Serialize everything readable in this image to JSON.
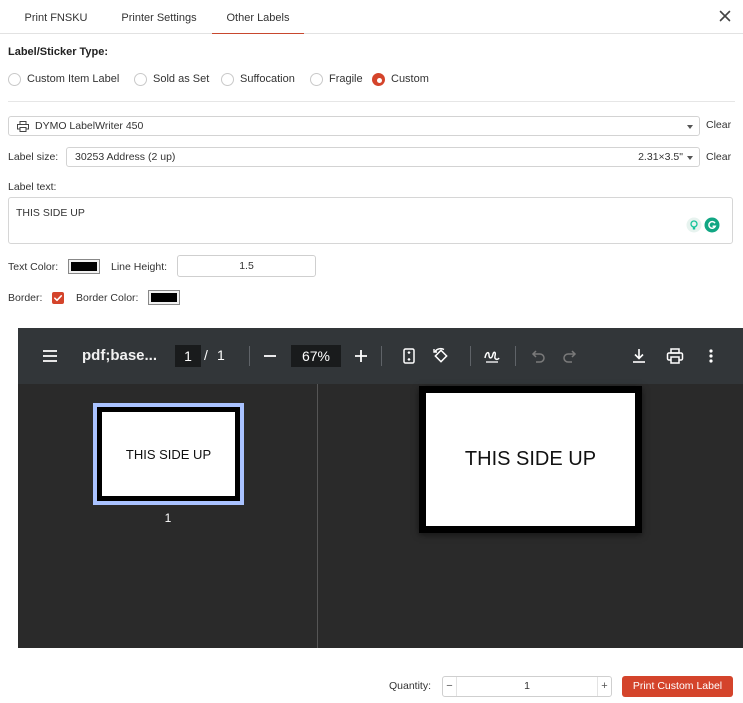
{
  "tabs": [
    {
      "label": "Print FNSKU"
    },
    {
      "label": "Printer Settings"
    },
    {
      "label": "Other Labels"
    }
  ],
  "label_type": {
    "title": "Label/Sticker Type:",
    "options": [
      {
        "label": "Custom Item Label",
        "checked": false
      },
      {
        "label": "Sold as Set",
        "checked": false
      },
      {
        "label": "Suffocation",
        "checked": false
      },
      {
        "label": "Fragile",
        "checked": false
      },
      {
        "label": "Custom",
        "checked": true
      }
    ]
  },
  "printer": {
    "value": "DYMO LabelWriter 450",
    "clear_label": "Clear"
  },
  "label_size": {
    "label": "Label size:",
    "value": "30253 Address (2 up)",
    "dimensions": "2.31×3.5\"",
    "clear_label": "Clear"
  },
  "label_text": {
    "label": "Label text:",
    "value": "THIS SIDE UP"
  },
  "text_color": {
    "label": "Text Color:",
    "value": "#000000"
  },
  "line_height": {
    "label": "Line Height:",
    "value": "1.5"
  },
  "border": {
    "label": "Border:",
    "checked": true
  },
  "border_color": {
    "label": "Border Color:",
    "value": "#000000"
  },
  "pdf_viewer": {
    "title": "pdf;base...",
    "current_page": "1",
    "separator": "/",
    "total_pages": "1",
    "zoom": "67%",
    "thumbnail_text": "THIS SIDE UP",
    "thumbnail_number": "1",
    "page_text": "THIS SIDE UP"
  },
  "footer": {
    "quantity_label": "Quantity:",
    "quantity_value": "1",
    "minus": "−",
    "plus": "+",
    "print_button": "Print Custom Label"
  },
  "colors": {
    "accent": "#d4442b",
    "viewer_bg": "#2a2a2a",
    "toolbar_bg": "#323639",
    "thumb_highlight": "#a9c2ff"
  }
}
